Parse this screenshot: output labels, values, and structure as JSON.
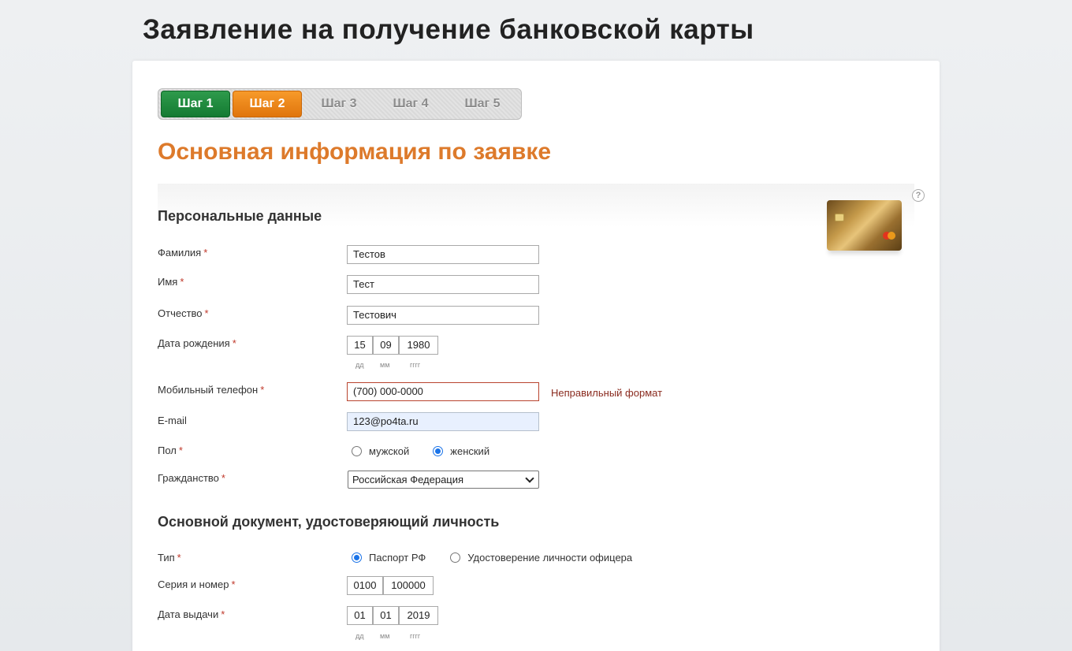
{
  "page": {
    "title": "Заявление на получение банковской карты",
    "section_title": "Основная информация по заявке"
  },
  "steps": [
    {
      "label": "Шаг 1",
      "state": "done"
    },
    {
      "label": "Шаг 2",
      "state": "active"
    },
    {
      "label": "Шаг 3",
      "state": "inactive"
    },
    {
      "label": "Шаг 4",
      "state": "inactive"
    },
    {
      "label": "Шаг 5",
      "state": "inactive"
    }
  ],
  "help": {
    "icon": "help-icon",
    "glyph": "?"
  },
  "personal": {
    "heading": "Персональные данные",
    "surname": {
      "label": "Фамилия",
      "required": "*",
      "value": "Тестов"
    },
    "name": {
      "label": "Имя",
      "required": "*",
      "value": "Тест"
    },
    "patronymic": {
      "label": "Отчество",
      "required": "*",
      "value": "Тестович"
    },
    "birthdate": {
      "label": "Дата рождения",
      "required": "*",
      "day": "15",
      "month": "09",
      "year": "1980",
      "hint_day": "дд",
      "hint_month": "мм",
      "hint_year": "гггг"
    },
    "phone": {
      "label": "Мобильный телефон",
      "required": "*",
      "value": "(700) 000-0000",
      "error": "Неправильный формат"
    },
    "email": {
      "label": "E-mail",
      "value": "123@po4ta.ru"
    },
    "gender": {
      "label": "Пол",
      "required": "*",
      "option_male": "мужской",
      "option_female": "женский",
      "selected": "женский"
    },
    "citizenship": {
      "label": "Гражданство",
      "required": "*",
      "value": "Российская Федерация"
    }
  },
  "document": {
    "heading": "Основной документ, удостоверяющий личность",
    "type": {
      "label": "Тип",
      "required": "*",
      "option_passport": "Паспорт РФ",
      "option_officer": "Удостоверение личности офицера",
      "selected": "Паспорт РФ"
    },
    "number": {
      "label": "Серия и номер",
      "required": "*",
      "series": "0100",
      "number": "100000"
    },
    "issue_date": {
      "label": "Дата выдачи",
      "required": "*",
      "day": "01",
      "month": "01",
      "year": "2019",
      "hint_day": "дд",
      "hint_month": "мм",
      "hint_year": "гггг"
    }
  },
  "colors": {
    "accent_orange": "#dd7a2b",
    "step_done": "#147a32",
    "step_active": "#e0750c",
    "error": "#8a2b1f"
  }
}
